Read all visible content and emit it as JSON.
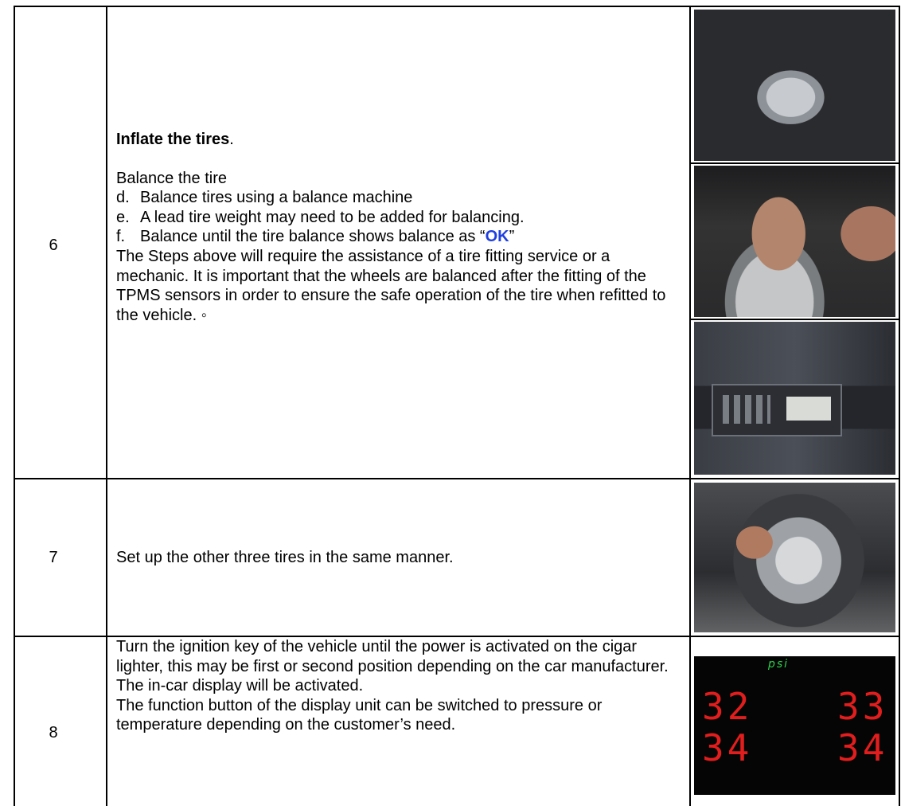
{
  "rows": [
    {
      "step": "6",
      "heading": "Inflate the tires",
      "heading_suffix": ".",
      "intro": "Balance the tire",
      "items": [
        {
          "label": "d.",
          "text": "Balance tires using a balance machine"
        },
        {
          "label": "e.",
          "text": "A lead tire weight may need to be added for balancing."
        },
        {
          "label": "f.",
          "text_before": "Balance until the tire balance shows balance as “",
          "ok": "OK",
          "text_after": "”"
        }
      ],
      "note": "The Steps above will require the assistance of a tire fitting service or a mechanic. It is important that the wheels are balanced after the fitting of the TPMS sensors in order to ensure the safe operation of the tire when refitted to the vehicle. ◦"
    },
    {
      "step": "7",
      "text": "Set up the other three tires in the same manner."
    },
    {
      "step": "8",
      "paragraph1": "Turn the ignition key of the vehicle until the power is activated on the cigar lighter, this may be first or second position depending on the car manufacturer. The in-car display will be activated.",
      "paragraph2": "The function button of the display unit can be switched to pressure or temperature depending on the customer’s need.",
      "display": {
        "unit": "psi",
        "front_left": "32",
        "front_right": "33",
        "rear_left": "34",
        "rear_right": "34"
      }
    }
  ]
}
